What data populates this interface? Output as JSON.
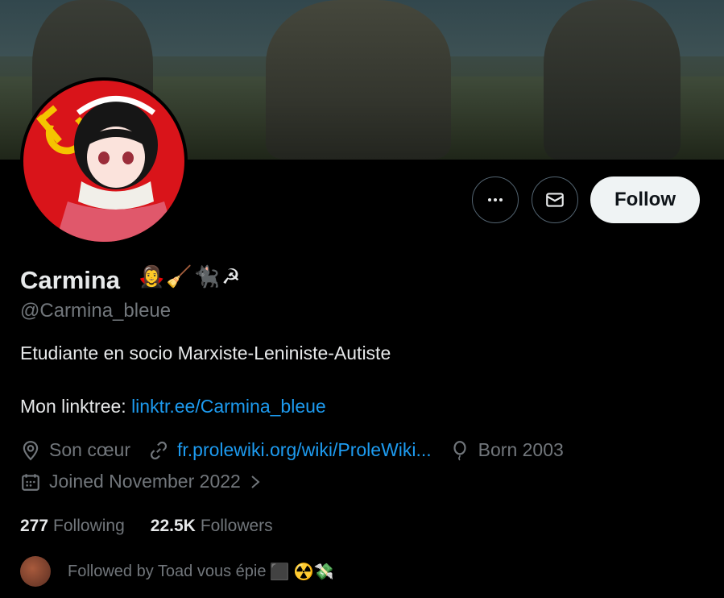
{
  "profile": {
    "name": "Carmina",
    "name_emoji": "🧛‍♀️🧹🐈‍⬛☭",
    "handle": "@Carmina_bleue",
    "bio_line1": "Etudiante en socio Marxiste-Leniniste-Autiste",
    "bio_line2_prefix": "Mon linktree: ",
    "bio_link": "linktr.ee/Carmina_bleue",
    "location": "Son cœur",
    "website": "fr.prolewiki.org/wiki/ProleWiki...",
    "birth": "Born 2003",
    "joined": "Joined November 2022"
  },
  "actions": {
    "more_icon": "more-dots-icon",
    "message_icon": "mail-icon",
    "follow_label": "Follow"
  },
  "stats": {
    "following_count": "277",
    "following_label": "Following",
    "followers_count": "22.5K",
    "followers_label": "Followers"
  },
  "followed_by": {
    "text": "Followed by Toad vous épie ",
    "emoji": "⬛ ☢️💸"
  },
  "colors": {
    "link": "#1d9bf0",
    "muted": "#71767b",
    "text": "#e7e9ea",
    "avatar_bg": "#d9141a"
  }
}
